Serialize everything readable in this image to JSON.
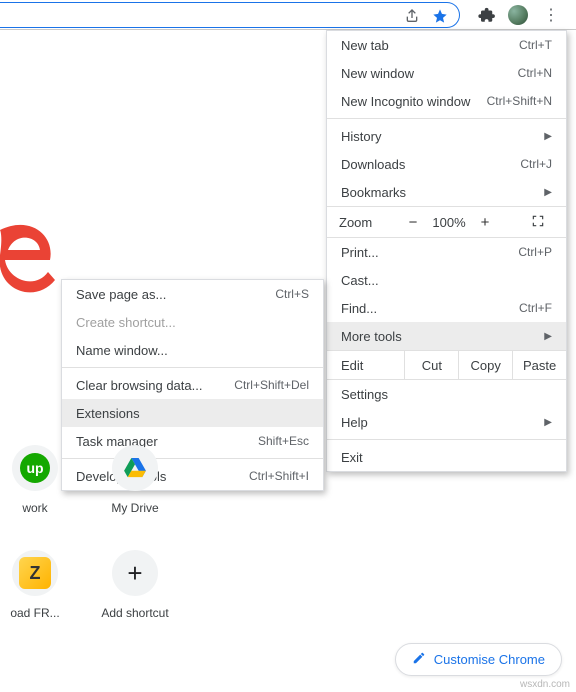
{
  "menu": {
    "new_tab": {
      "label": "New tab",
      "shortcut": "Ctrl+T"
    },
    "new_window": {
      "label": "New window",
      "shortcut": "Ctrl+N"
    },
    "new_incognito": {
      "label": "New Incognito window",
      "shortcut": "Ctrl+Shift+N"
    },
    "history": {
      "label": "History"
    },
    "downloads": {
      "label": "Downloads",
      "shortcut": "Ctrl+J"
    },
    "bookmarks": {
      "label": "Bookmarks"
    },
    "zoom": {
      "label": "Zoom",
      "minus": "−",
      "pct": "100%",
      "plus": "+"
    },
    "print": {
      "label": "Print...",
      "shortcut": "Ctrl+P"
    },
    "cast": {
      "label": "Cast..."
    },
    "find": {
      "label": "Find...",
      "shortcut": "Ctrl+F"
    },
    "more_tools": {
      "label": "More tools"
    },
    "edit": {
      "label": "Edit",
      "cut": "Cut",
      "copy": "Copy",
      "paste": "Paste"
    },
    "settings": {
      "label": "Settings"
    },
    "help": {
      "label": "Help"
    },
    "exit": {
      "label": "Exit"
    }
  },
  "sub": {
    "save_page": {
      "label": "Save page as...",
      "shortcut": "Ctrl+S"
    },
    "create_shortcut": {
      "label": "Create shortcut..."
    },
    "name_window": {
      "label": "Name window..."
    },
    "clear_data": {
      "label": "Clear browsing data...",
      "shortcut": "Ctrl+Shift+Del"
    },
    "extensions": {
      "label": "Extensions"
    },
    "task_manager": {
      "label": "Task manager",
      "shortcut": "Shift+Esc"
    },
    "dev_tools": {
      "label": "Developer tools",
      "shortcut": "Ctrl+Shift+I"
    }
  },
  "tiles": {
    "work": "work",
    "mydrive": "My Drive",
    "zoad": "oad FR...",
    "add": "Add shortcut"
  },
  "customise": "Customise Chrome",
  "watermark": "wsxdn.com"
}
